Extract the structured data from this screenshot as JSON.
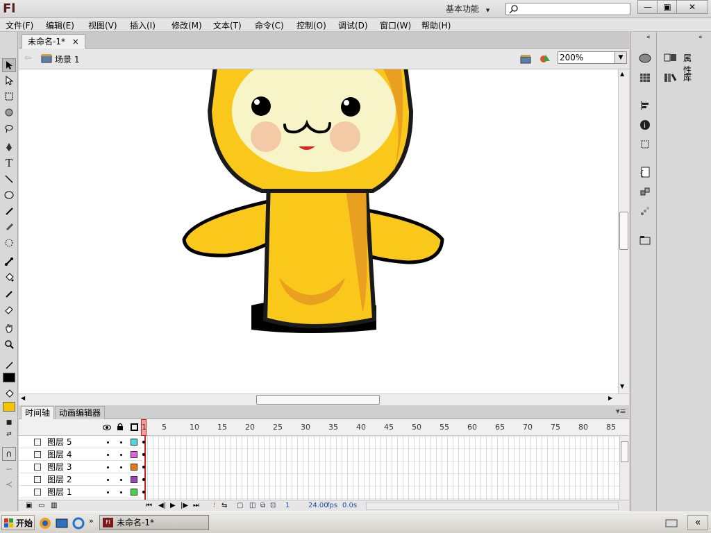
{
  "app": {
    "logo": "Fl",
    "workspace": "基本功能",
    "workspace_arrow": "▼"
  },
  "window_controls": {
    "minimize": "—",
    "restore": "▣",
    "close": "✕"
  },
  "menu": [
    "文件(F)",
    "编辑(E)",
    "视图(V)",
    "插入(I)",
    "修改(M)",
    "文本(T)",
    "命令(C)",
    "控制(O)",
    "调试(D)",
    "窗口(W)",
    "帮助(H)"
  ],
  "document": {
    "tab_title": "未命名-1*",
    "tab_close": "×",
    "scene_label": "场景 1",
    "zoom": "200%"
  },
  "timeline": {
    "tabs": [
      "时间轴",
      "动画编辑器"
    ],
    "frame_numbers": [
      "1",
      "5",
      "10",
      "15",
      "20",
      "25",
      "30",
      "35",
      "40",
      "45",
      "50",
      "55",
      "60",
      "65",
      "70",
      "75",
      "80",
      "85"
    ],
    "layers": [
      {
        "name": "图层 5",
        "color": "#48d8e0"
      },
      {
        "name": "图层 4",
        "color": "#e060e0"
      },
      {
        "name": "图层 3",
        "color": "#f07800"
      },
      {
        "name": "图层 2",
        "color": "#a040c8"
      },
      {
        "name": "图层 1",
        "color": "#40d840"
      }
    ],
    "status": {
      "current_frame": "1",
      "fps": "24.00",
      "fps_unit": "fps",
      "time": "0.0s"
    }
  },
  "panels": {
    "properties": "属性",
    "library": "库"
  },
  "taskbar": {
    "start": "开始",
    "task": "未命名-1*",
    "tray_arrow": "«"
  },
  "colors": {
    "stroke": "#000000",
    "fill": "#f5c400"
  },
  "icons": [
    "selection-tool-icon",
    "subselection-tool-icon",
    "free-transform-icon",
    "3d-rotation-icon",
    "lasso-icon",
    "pen-icon",
    "text-icon",
    "line-icon",
    "oval-icon",
    "pencil-icon",
    "brush-icon",
    "deco-icon",
    "bone-icon",
    "paint-bucket-icon",
    "eyedropper-icon",
    "eraser-icon",
    "hand-icon",
    "zoom-icon"
  ]
}
